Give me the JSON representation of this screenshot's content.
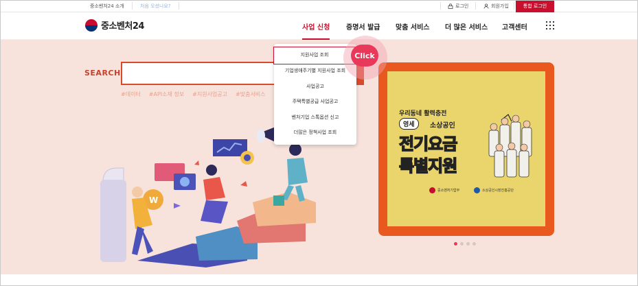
{
  "topbar": {
    "about": "중소벤처24 소개",
    "first_visit": "처음 오셨나요?",
    "login": "로그인",
    "signup": "회원가입",
    "integrated_login": "통합 로그인"
  },
  "header": {
    "logo_text": "중소벤처24",
    "nav": [
      "사업 신청",
      "증명서 발급",
      "맞춤 서비스",
      "더 많은 서비스",
      "고객센터"
    ]
  },
  "search": {
    "label": "SEARCH",
    "value": "",
    "tags": [
      "#데이터",
      "#API소재 정보",
      "#지원사업공고",
      "#맞춤서비스"
    ]
  },
  "dropdown": {
    "items": [
      "지원사업 조회",
      "기업생애주기별 지원사업 조회",
      "사업공고",
      "주택특별공급 사업공고",
      "벤처기업 스톡옵션 신고",
      "더많은 정책사업 조회"
    ],
    "click_label": "Click"
  },
  "banner": {
    "subtitle": "우리동네 활력충전",
    "chip": "영세",
    "subtitle2": "소상공인",
    "title_line1": "전기요금",
    "title_line2": "특별지원",
    "footer_left": "중소벤처기업부",
    "footer_right": "소상공인시장진흥공단",
    "pages": 4,
    "active_page": 1
  },
  "colors": {
    "accent": "#c8102e",
    "hero_bg": "#f7e3dc",
    "banner_frame": "#e8581f",
    "banner_fill": "#ead56c"
  }
}
